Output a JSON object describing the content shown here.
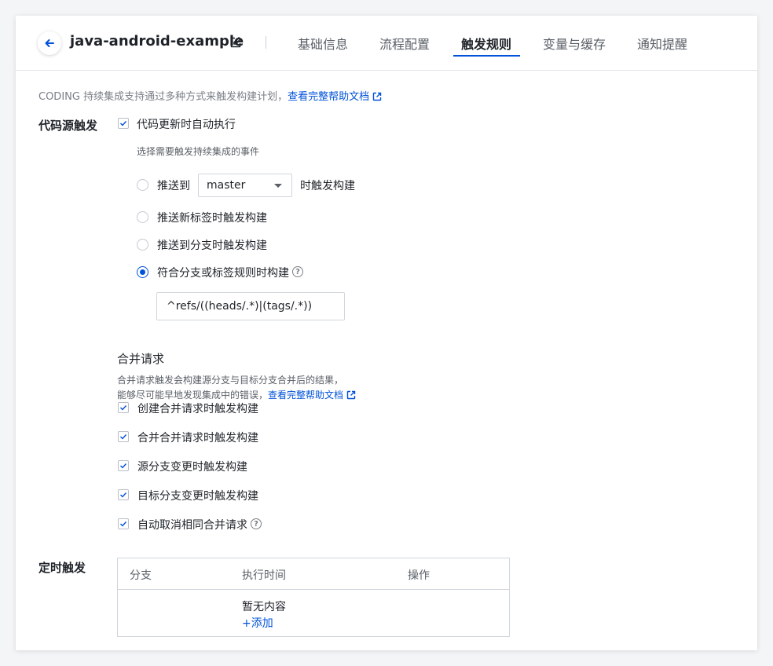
{
  "header": {
    "title": "java-android-example",
    "tabs": [
      {
        "label": "基础信息"
      },
      {
        "label": "流程配置"
      },
      {
        "label": "触发规则"
      },
      {
        "label": "变量与缓存"
      },
      {
        "label": "通知提醒"
      }
    ],
    "active_tab": "触发规则"
  },
  "intro": {
    "text": "CODING 持续集成支持通过多种方式来触发构建计划，",
    "link": "查看完整帮助文档"
  },
  "code_source": {
    "label": "代码源触发",
    "auto_run_label": "代码更新时自动执行",
    "events_hint": "选择需要触发持续集成的事件",
    "push_to_label": "推送到",
    "branch_select_value": "master",
    "push_to_suffix": "时触发构建",
    "options": [
      {
        "label": "推送新标签时触发构建",
        "checked": false
      },
      {
        "label": "推送到分支时触发构建",
        "checked": false
      },
      {
        "label": "符合分支或标签规则时构建",
        "checked": true
      }
    ],
    "rule_value": "^refs/((heads/.*)|(tags/.*))"
  },
  "merge_request": {
    "title": "合并请求",
    "desc_line1": "合并请求触发会构建源分支与目标分支合并后的结果，",
    "desc_line2": "能够尽可能早地发现集成中的错误，",
    "link": "查看完整帮助文档",
    "items": [
      {
        "label": "创建合并请求时触发构建",
        "checked": true
      },
      {
        "label": "合并合并请求时触发构建",
        "checked": true
      },
      {
        "label": "源分支变更时触发构建",
        "checked": true
      },
      {
        "label": "目标分支变更时触发构建",
        "checked": true
      },
      {
        "label": "自动取消相同合并请求",
        "checked": true
      }
    ]
  },
  "schedule": {
    "label": "定时触发",
    "columns": [
      "分支",
      "执行时间",
      "操作"
    ],
    "empty_text": "暂无内容",
    "add_label": "+添加"
  },
  "colors": {
    "accent": "#0052d9",
    "text": "#1f2329",
    "muted": "#7a7f87",
    "border": "#d0d5dc"
  }
}
